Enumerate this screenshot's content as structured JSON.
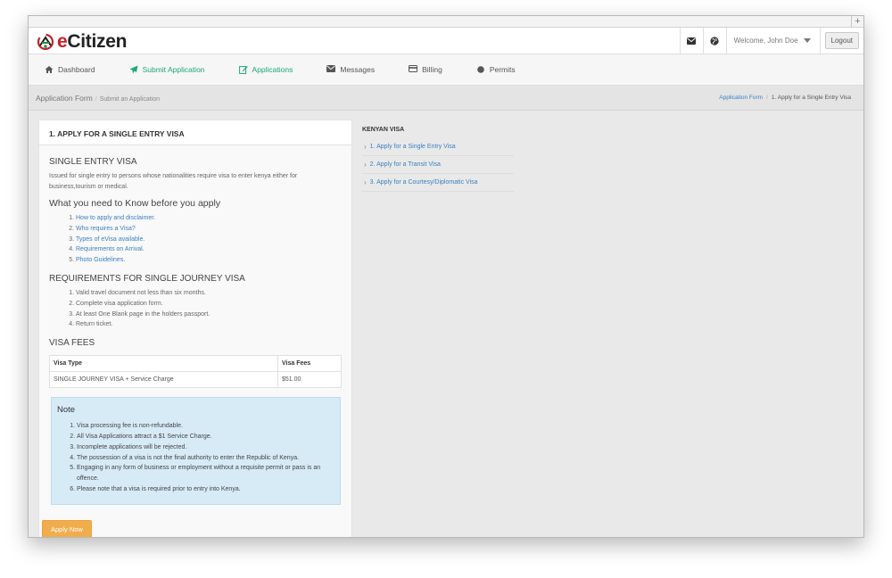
{
  "window": {
    "titlebar_button": "+"
  },
  "header": {
    "logo_prefix": "e",
    "logo_rest": "Citizen",
    "welcome": "Welcome, John Doe",
    "logout_label": "Logout"
  },
  "nav": {
    "items": [
      {
        "label": "Dashboard",
        "icon": "home-icon",
        "active": false
      },
      {
        "label": "Submit Application",
        "icon": "send-icon",
        "active": true
      },
      {
        "label": "Applications",
        "icon": "edit-icon",
        "active": true
      },
      {
        "label": "Messages",
        "icon": "envelope-icon",
        "active": false
      },
      {
        "label": "Billing",
        "icon": "credit-card-icon",
        "active": false
      },
      {
        "label": "Permits",
        "icon": "circle-icon",
        "active": false
      }
    ]
  },
  "breadcrumb": {
    "left_title": "Application Form",
    "left_sub": "Submit an Application",
    "right_link": "Application Form",
    "right_current": "1. Apply for a Single Entry Visa"
  },
  "panel": {
    "heading": "1. APPLY FOR A SINGLE ENTRY VISA",
    "sec1_title": "SINGLE ENTRY VISA",
    "sec1_text": "Issued for single entry to persons whose nationalities require visa to enter kenya either for business,tourism or medical.",
    "sec2_title": "What you need to Know before you apply",
    "know_links": [
      "How to apply and disclaimer.",
      "Who requires a Visa?",
      "Types of eVisa available.",
      "Requirements on Arrival.",
      "Photo Guidelines."
    ],
    "sec3_title": "REQUIREMENTS FOR SINGLE JOURNEY VISA",
    "requirements": [
      "Valid travel document not less than six months.",
      "Complete visa application form.",
      "At least One Blank page in the holders passport.",
      "Return ticket."
    ],
    "sec4_title": "VISA FEES",
    "fees_table": {
      "headers": [
        "Visa Type",
        "Visa Fees"
      ],
      "rows": [
        [
          "SINGLE JOURNEY VISA + Service Charge",
          "$51.00"
        ]
      ]
    },
    "note_title": "Note",
    "notes": [
      "Visa processing fee is non-refundable.",
      "All Visa Applications attract a $1 Service Charge.",
      "Incomplete applications will be rejected.",
      "The possession of a visa is not the final authority to enter the Republic of Kenya.",
      "Engaging in any form of business or employment without a requisite permit or pass is an offence.",
      "Please note that a visa is required prior to entry into Kenya."
    ],
    "apply_label": "Apply Now"
  },
  "sidebar": {
    "title": "KENYAN VISA",
    "items": [
      "1. Apply for a Single Entry Visa",
      "2. Apply for a Transit Visa",
      "3. Apply for a Courtesy/Diplomatic Visa"
    ]
  },
  "colors": {
    "accent": "#1fa67a",
    "link": "#3b7fc1",
    "apply": "#f0ad4e",
    "note_bg": "#d7ebf6",
    "logo_red": "#c8202a"
  }
}
